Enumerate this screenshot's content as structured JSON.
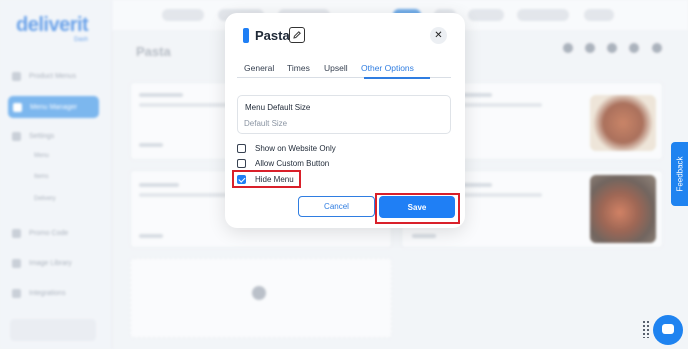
{
  "app": {
    "logo": "deliverit",
    "logo_sub": "Dash",
    "sidebar": [
      "Product Menus",
      "Menu Manager",
      "Settings",
      "Menu",
      "Items",
      "Delivery",
      "Promo Code",
      "Image Library",
      "Integrations"
    ],
    "page_title": "Pasta"
  },
  "modal": {
    "title": "Pasta",
    "accent_color": "#1f7ff5",
    "edit_icon": "edit-icon",
    "close_icon": "close-icon",
    "tabs": [
      {
        "label": "General",
        "active": false
      },
      {
        "label": "Times",
        "active": false
      },
      {
        "label": "Upsell",
        "active": false
      },
      {
        "label": "Other Options",
        "active": true
      }
    ],
    "menu_default_size": {
      "label": "Menu Default Size",
      "placeholder": "Default Size",
      "value": ""
    },
    "options": [
      {
        "label": "Show on Website Only",
        "checked": false
      },
      {
        "label": "Allow Custom Button",
        "checked": false
      },
      {
        "label": "Hide Menu",
        "checked": true
      }
    ],
    "cancel_label": "Cancel",
    "save_label": "Save",
    "highlight_color": "#d9202a"
  },
  "feedback_label": "Feedback"
}
